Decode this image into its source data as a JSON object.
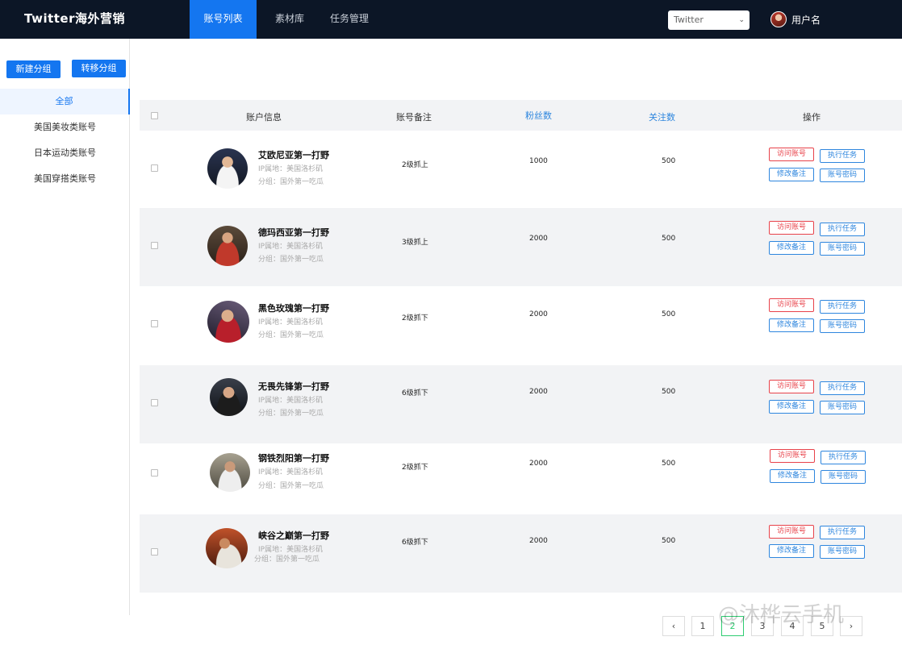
{
  "header": {
    "brand": "Twitter海外营销",
    "nav": [
      "账号列表",
      "素材库",
      "任务管理"
    ],
    "platform_select": "Twitter",
    "username": "用户名"
  },
  "sidebar": {
    "new_group": "新建分组",
    "move_group": "转移分组",
    "groups": [
      "全部",
      "美国美妆类账号",
      "日本运动类账号",
      "美国穿搭类账号"
    ]
  },
  "table": {
    "headers": {
      "account_info": "账户信息",
      "remark": "账号备注",
      "fans": "粉丝数",
      "follows": "关注数",
      "actions": "操作"
    },
    "action_labels": {
      "visit": "访问账号",
      "execute": "执行任务",
      "edit_remark": "修改备注",
      "password": "账号密码"
    },
    "rows": [
      {
        "name": "艾欧尼亚第一打野",
        "ip": "IP属地：美国洛杉矶",
        "group": "分组：国外第一吃瓜",
        "remark": "2级抓上",
        "fans": "1000",
        "follows": "500"
      },
      {
        "name": "德玛西亚第一打野",
        "ip": "IP属地：美国洛杉矶",
        "group": "分组：国外第一吃瓜",
        "remark": "3级抓上",
        "fans": "2000",
        "follows": "500"
      },
      {
        "name": "黑色玫瑰第一打野",
        "ip": "IP属地：美国洛杉矶",
        "group": "分组：国外第一吃瓜",
        "remark": "2级抓下",
        "fans": "2000",
        "follows": "500"
      },
      {
        "name": "无畏先锋第一打野",
        "ip": "IP属地：美国洛杉矶",
        "group": "分组：国外第一吃瓜",
        "remark": "6级抓下",
        "fans": "2000",
        "follows": "500"
      },
      {
        "name": "钢铁烈阳第一打野",
        "ip": "IP属地：美国洛杉矶",
        "group": "分组：国外第一吃瓜",
        "remark": "2级抓下",
        "fans": "2000",
        "follows": "500"
      },
      {
        "name": "峡谷之巅第一打野",
        "ip": "IP属地：美国洛杉矶",
        "group": "分组：国外第一吃瓜",
        "remark": "6级抓下",
        "fans": "2000",
        "follows": "500"
      }
    ]
  },
  "pagination": {
    "prev_icon": "chevron-left-icon",
    "pages": [
      "1",
      "2",
      "3",
      "4",
      "5"
    ],
    "current": "2",
    "next_icon": "chevron-right-icon"
  },
  "watermark": "@沐桦云手机",
  "colors": {
    "topbar": "#0c1626",
    "primary": "#1476f0",
    "danger": "#e8424a",
    "link": "#2e86de"
  }
}
